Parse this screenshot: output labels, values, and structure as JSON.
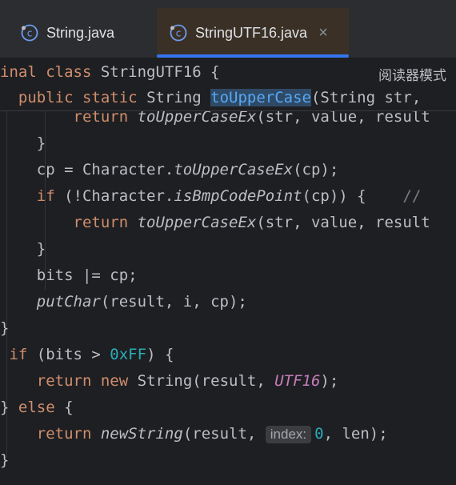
{
  "tabs": [
    {
      "label": "String.java",
      "icon": "java-class-icon",
      "active": false
    },
    {
      "label": "StringUTF16.java",
      "icon": "java-class-icon",
      "active": true,
      "close": "×"
    }
  ],
  "reader_mode": "阅读器模式",
  "sticky": {
    "line1": {
      "a": "inal",
      "b": " ",
      "c": "class",
      "d": " StringUTF16 {"
    },
    "line2": {
      "a": "  ",
      "b": "public",
      "c": " ",
      "d": "static",
      "e": " String ",
      "f": "toUpperCase",
      "g": "(String str, "
    }
  },
  "code": {
    "l1": {
      "a": "        ",
      "b": "return",
      "c": " ",
      "d": "toUpperCaseEx",
      "e": "(str, value, result"
    },
    "l2": {
      "a": "    }"
    },
    "l3": {
      "a": "    cp = Character.",
      "b": "toUpperCaseEx",
      "c": "(cp);"
    },
    "l4": {
      "a": "    ",
      "b": "if",
      "c": " (!Character.",
      "d": "isBmpCodePoint",
      "e": "(cp)) {    ",
      "f": "//"
    },
    "l5": {
      "a": "        ",
      "b": "return",
      "c": " ",
      "d": "toUpperCaseEx",
      "e": "(str, value, result"
    },
    "l6": {
      "a": "    }"
    },
    "l7": {
      "a": "    bits |= cp;"
    },
    "l8": {
      "a": "    ",
      "b": "putChar",
      "c": "(result, i, cp);"
    },
    "l9": {
      "a": "}"
    },
    "l10": {
      "a": " ",
      "b": "if",
      "c": " (bits > ",
      "d": "0xFF",
      "e": ") {"
    },
    "l11": {
      "a": "    ",
      "b": "return",
      "c": " ",
      "d": "new",
      "e": " String(result, ",
      "f": "UTF16",
      "g": ");"
    },
    "l12": {
      "a": "} ",
      "b": "else",
      "c": " {"
    },
    "l13": {
      "a": "    ",
      "b": "return",
      "c": " ",
      "d": "newString",
      "e": "(result, ",
      "hint": "index:",
      "f": "0",
      "g": ", len);"
    },
    "l14": {
      "a": "}"
    }
  },
  "colors": {
    "keyword": "#cf8e6d",
    "function_decl": "#56a8f5",
    "number": "#2aacb8",
    "constant": "#c77dbb",
    "text": "#bcbec4",
    "background": "#1e1f22",
    "tab_active_underline": "#3574f0"
  }
}
